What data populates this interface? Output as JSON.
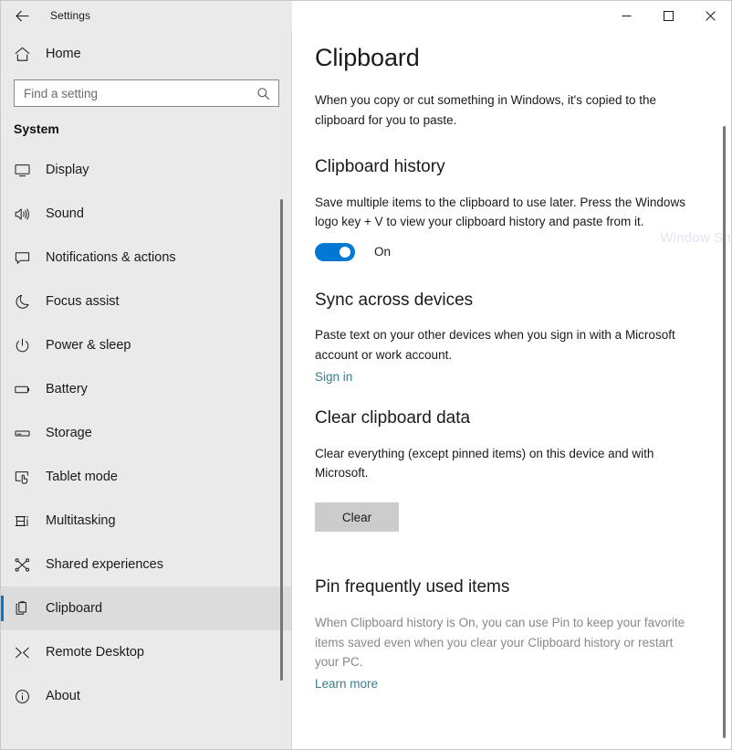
{
  "window": {
    "title": "Settings",
    "back_icon": "back-arrow-icon",
    "controls": {
      "minimize": "─",
      "maximize": "□",
      "close": "✕"
    }
  },
  "sidebar": {
    "home": {
      "label": "Home",
      "icon": "home-icon"
    },
    "search": {
      "placeholder": "Find a setting",
      "value": "",
      "icon": "search-icon"
    },
    "section_label": "System",
    "items": [
      {
        "label": "Display",
        "icon": "monitor-icon",
        "selected": false
      },
      {
        "label": "Sound",
        "icon": "speaker-icon",
        "selected": false
      },
      {
        "label": "Notifications & actions",
        "icon": "comment-icon",
        "selected": false
      },
      {
        "label": "Focus assist",
        "icon": "moon-icon",
        "selected": false
      },
      {
        "label": "Power & sleep",
        "icon": "power-icon",
        "selected": false
      },
      {
        "label": "Battery",
        "icon": "battery-icon",
        "selected": false
      },
      {
        "label": "Storage",
        "icon": "drive-icon",
        "selected": false
      },
      {
        "label": "Tablet mode",
        "icon": "tablet-touch-icon",
        "selected": false
      },
      {
        "label": "Multitasking",
        "icon": "multitasking-icon",
        "selected": false
      },
      {
        "label": "Shared experiences",
        "icon": "share-nodes-icon",
        "selected": false
      },
      {
        "label": "Clipboard",
        "icon": "clipboard-icon",
        "selected": true
      },
      {
        "label": "Remote Desktop",
        "icon": "remote-desktop-icon",
        "selected": false
      },
      {
        "label": "About",
        "icon": "info-circle-icon",
        "selected": false
      }
    ]
  },
  "main": {
    "page_title": "Clipboard",
    "intro": "When you copy or cut something in Windows, it's copied to the clipboard for you to paste.",
    "clipboard_history": {
      "heading": "Clipboard history",
      "description": "Save multiple items to the clipboard to use later. Press the Windows logo key + V to view your clipboard history and paste from it.",
      "toggle_state": "On"
    },
    "sync": {
      "heading": "Sync across devices",
      "description": "Paste text on your other devices when you sign in with a Microsoft account or work account.",
      "link": "Sign in"
    },
    "clear": {
      "heading": "Clear clipboard data",
      "description": "Clear everything (except pinned items) on this device and with Microsoft.",
      "button": "Clear"
    },
    "pin": {
      "heading": "Pin frequently used items",
      "description": "When Clipboard history is On, you can use Pin to keep your favorite items saved even when you clear your Clipboard history or restart your PC.",
      "link": "Learn more"
    }
  },
  "watermark": "Window Sn",
  "colors": {
    "accent": "#0078d4",
    "sidebar_bg": "#eaeaea",
    "link": "#3a7d8c",
    "button_bg": "#cccccc",
    "muted_text": "#888888"
  }
}
